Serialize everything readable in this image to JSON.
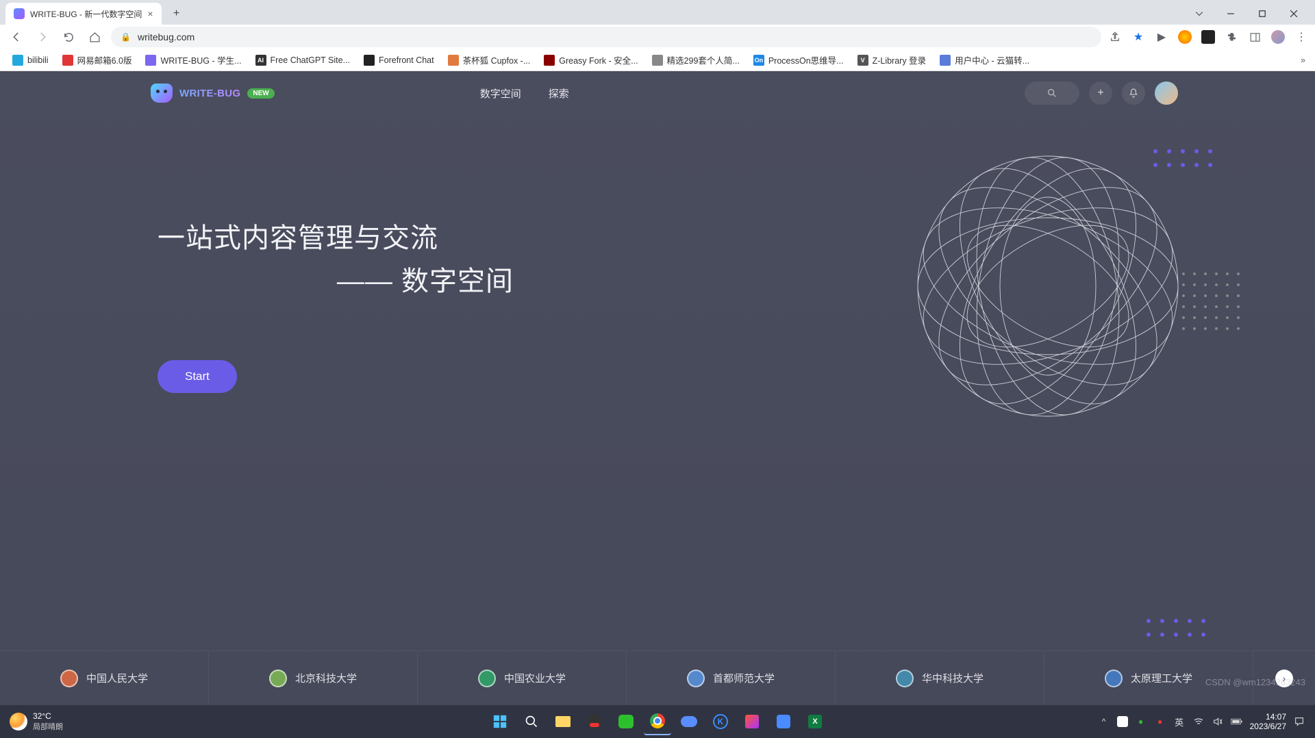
{
  "browser": {
    "tab_title": "WRITE-BUG - 新一代数字空间",
    "url": "writebug.com",
    "bookmarks": [
      {
        "label": "bilibili",
        "color": "#22a8dd"
      },
      {
        "label": "网易邮箱6.0版",
        "color": "#e03636"
      },
      {
        "label": "WRITE-BUG - 学生...",
        "color": "#7b68ee"
      },
      {
        "label": "Free ChatGPT Site...",
        "color": "#333",
        "text": "AI"
      },
      {
        "label": "Forefront Chat",
        "color": "#222"
      },
      {
        "label": "茶杯狐 Cupfox -...",
        "color": "#e07a3f"
      },
      {
        "label": "Greasy Fork - 安全...",
        "color": "#8b0000"
      },
      {
        "label": "精选299套个人简...",
        "color": "#888"
      },
      {
        "label": "ProcessOn思维导...",
        "color": "#1e88e5",
        "text": "On"
      },
      {
        "label": "Z-Library 登录",
        "color": "#555",
        "text": "V"
      },
      {
        "label": "用户中心 - 云猫转...",
        "color": "#5b7cdb"
      }
    ]
  },
  "site": {
    "logo_text": "WRITE-BUG",
    "badge": "NEW",
    "nav": [
      "数字空间",
      "探索"
    ],
    "hero_line1": "一站式内容管理与交流",
    "hero_line2": "—— 数字空间",
    "start_label": "Start",
    "universities": [
      "中国人民大学",
      "北京科技大学",
      "中国农业大学",
      "首都师范大学",
      "华中科技大学",
      "太原理工大学"
    ]
  },
  "taskbar": {
    "temp": "32°C",
    "weather": "局部晴朗",
    "ime": "英",
    "time": "14:07",
    "date": "2023/6/27"
  },
  "watermark": "CSDN @wm1234263243"
}
